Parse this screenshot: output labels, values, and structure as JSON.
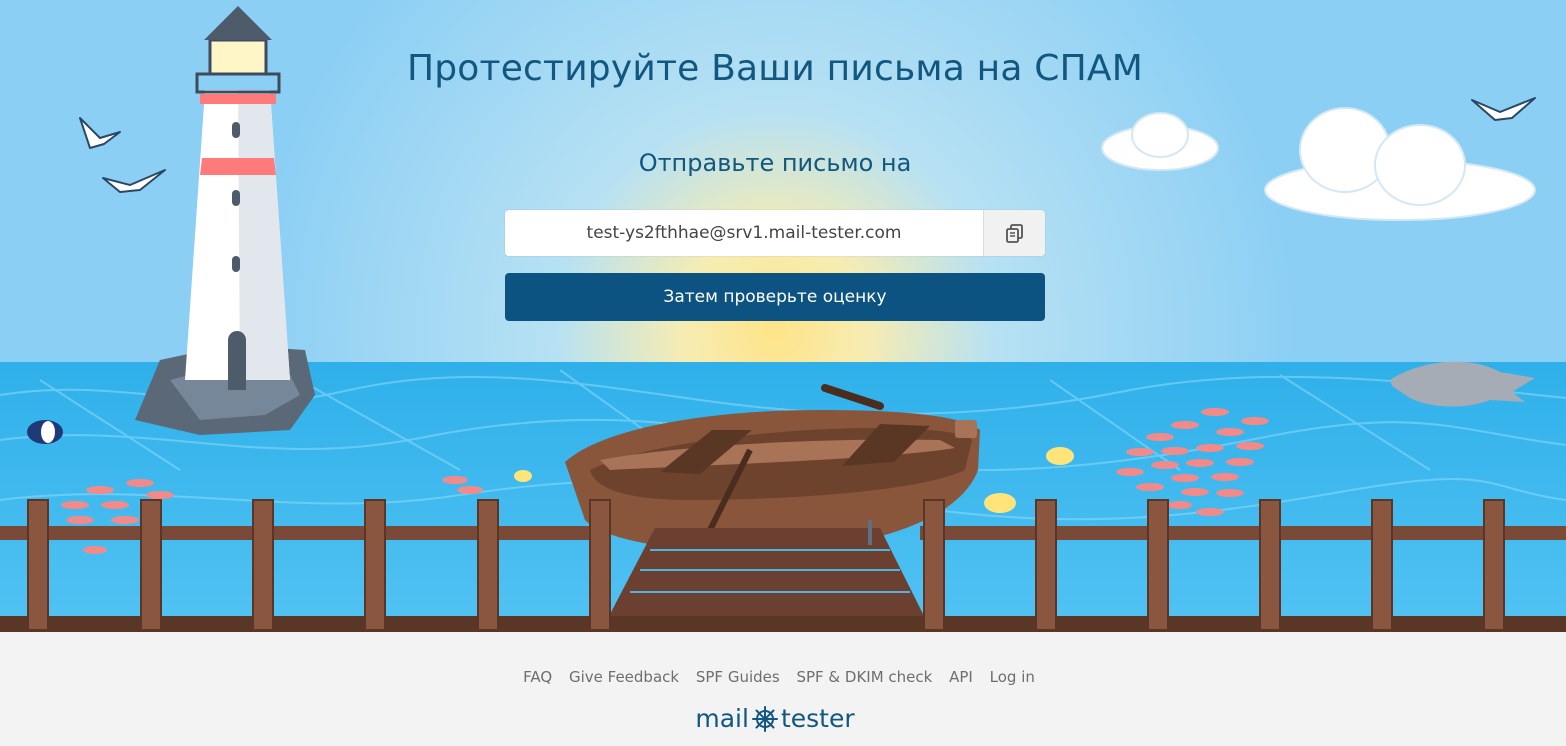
{
  "hero": {
    "title": "Протестируйте Ваши письма на СПАМ",
    "subtitle": "Отправьте письмо на",
    "email_value": "test-ys2fthhae@srv1.mail-tester.com",
    "check_button_label": "Затем проверьте оценку"
  },
  "footer": {
    "links": [
      "FAQ",
      "Give Feedback",
      "SPF Guides",
      "SPF & DKIM check",
      "API",
      "Log in"
    ],
    "logo_left": "mail",
    "logo_right": "tester"
  },
  "colors": {
    "brand": "#11577f",
    "button": "#0d5382",
    "sky": "#8ccff5",
    "sea": "#3fb5ec",
    "footer_bg": "#f3f3f3"
  }
}
